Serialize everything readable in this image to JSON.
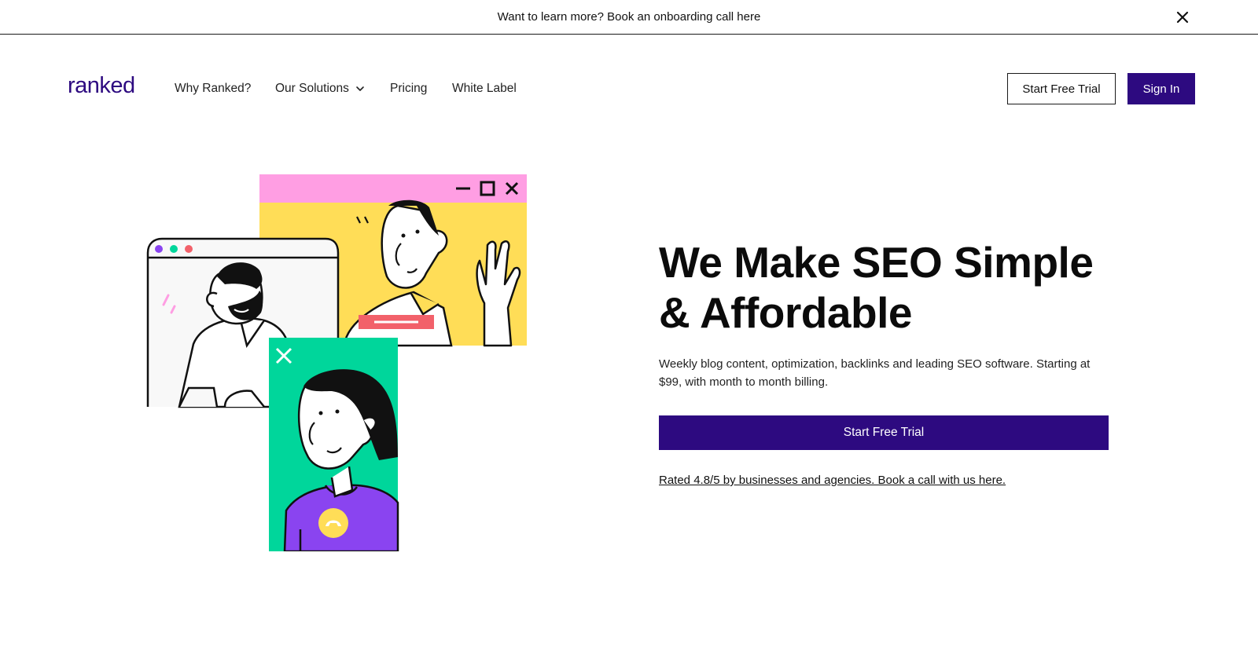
{
  "announcement": {
    "text": "Want to learn more? Book an onboarding call here",
    "close_icon": "close-icon"
  },
  "header": {
    "logo_text": "ranked",
    "nav": {
      "why": "Why Ranked?",
      "solutions": "Our Solutions",
      "pricing": "Pricing",
      "white_label": "White Label"
    },
    "start_trial": "Start Free Trial",
    "sign_in": "Sign In"
  },
  "hero": {
    "title_line1": "We Make SEO Simple",
    "title_line2": "& Affordable",
    "subtitle": "Weekly blog content, optimization, backlinks and leading SEO software. Starting at $99, with month to month billing.",
    "cta": "Start Free Trial",
    "rated_link": "Rated 4.8/5 by businesses and agencies. Book a call with us here."
  },
  "colors": {
    "brand_purple": "#2d0a80",
    "pink": "#ff9ee3",
    "yellow": "#ffdd57",
    "green": "#00d69b",
    "violet": "#8a44f0",
    "coral": "#f2616a"
  }
}
